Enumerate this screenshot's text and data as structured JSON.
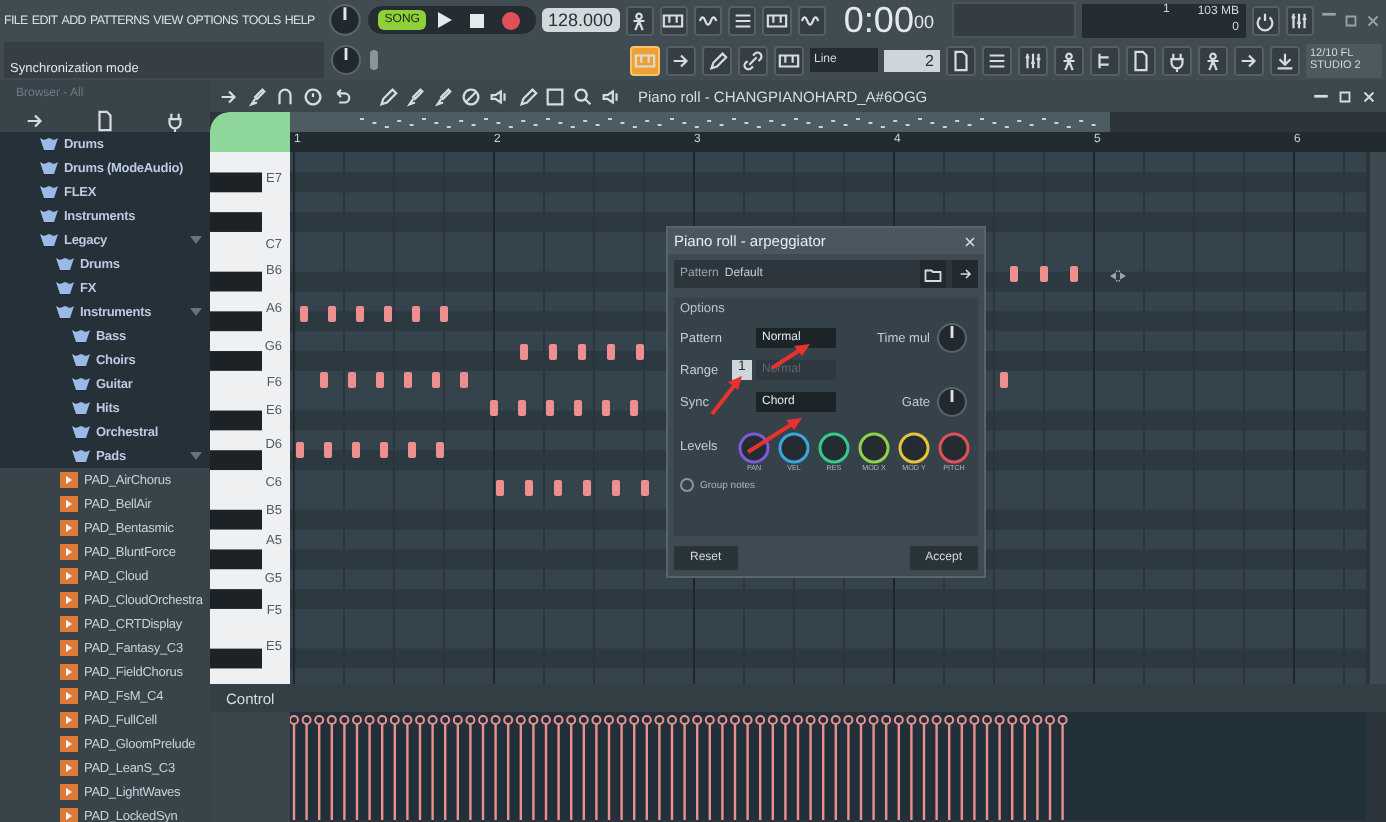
{
  "menu": [
    "FILE",
    "EDIT",
    "ADD",
    "PATTERNS",
    "VIEW",
    "OPTIONS",
    "TOOLS",
    "HELP"
  ],
  "top_bar": {
    "mode": "SONG",
    "tempo": "128.000",
    "time": "0:00",
    "time_fraction": "00",
    "cpu": "1",
    "memory": "103 MB",
    "polyphony": "0",
    "hint": "Synchronization mode",
    "snap": "Line",
    "step": "2",
    "news": [
      "12/10 FL",
      "STUDIO 2"
    ]
  },
  "browser": {
    "title": "Browser - All",
    "tree": [
      {
        "label": "Drums",
        "kind": "folder",
        "expanded": false
      },
      {
        "label": "Drums (ModeAudio)",
        "kind": "folder",
        "expanded": false
      },
      {
        "label": "FLEX",
        "kind": "folder",
        "expanded": false
      },
      {
        "label": "Instruments",
        "kind": "folder",
        "expanded": false
      },
      {
        "label": "Legacy",
        "kind": "folder",
        "expanded": true,
        "children": [
          {
            "label": "Drums",
            "kind": "folder",
            "expanded": false
          },
          {
            "label": "FX",
            "kind": "folder",
            "expanded": false
          },
          {
            "label": "Instruments",
            "kind": "folder",
            "expanded": true,
            "children": [
              {
                "label": "Bass",
                "kind": "folder",
                "expanded": false
              },
              {
                "label": "Choirs",
                "kind": "folder",
                "expanded": false
              },
              {
                "label": "Guitar",
                "kind": "folder",
                "expanded": false
              },
              {
                "label": "Hits",
                "kind": "folder",
                "expanded": false
              },
              {
                "label": "Orchestral",
                "kind": "folder",
                "expanded": false
              },
              {
                "label": "Pads",
                "kind": "folder",
                "expanded": true,
                "children": [
                  {
                    "label": "PAD_AirChorus",
                    "kind": "file",
                    "expanded": false
                  },
                  {
                    "label": "PAD_BellAir",
                    "kind": "file",
                    "expanded": false
                  },
                  {
                    "label": "PAD_Bentasmic",
                    "kind": "file",
                    "expanded": false
                  },
                  {
                    "label": "PAD_BluntForce",
                    "kind": "file",
                    "expanded": false
                  },
                  {
                    "label": "PAD_Cloud",
                    "kind": "file",
                    "expanded": false
                  },
                  {
                    "label": "PAD_CloudOrchestra",
                    "kind": "file",
                    "expanded": false
                  },
                  {
                    "label": "PAD_CRTDisplay",
                    "kind": "file",
                    "expanded": false
                  },
                  {
                    "label": "PAD_Fantasy_C3",
                    "kind": "file",
                    "expanded": false
                  },
                  {
                    "label": "PAD_FieldChorus",
                    "kind": "file",
                    "expanded": false
                  },
                  {
                    "label": "PAD_FsM_C4",
                    "kind": "file",
                    "expanded": false
                  },
                  {
                    "label": "PAD_FullCell",
                    "kind": "file",
                    "expanded": false
                  },
                  {
                    "label": "PAD_GloomPrelude",
                    "kind": "file",
                    "expanded": false
                  },
                  {
                    "label": "PAD_LeanS_C3",
                    "kind": "file",
                    "expanded": false
                  },
                  {
                    "label": "PAD_LightWaves",
                    "kind": "file",
                    "expanded": false
                  },
                  {
                    "label": "PAD_LockedSyn",
                    "kind": "file",
                    "expanded": false
                  }
                ]
              }
            ]
          }
        ]
      }
    ]
  },
  "piano_roll": {
    "title": "Piano roll - CHANGPIANOHARD_A#6OGG",
    "bars": [
      "1",
      "2",
      "3",
      "4",
      "5",
      "6"
    ],
    "key_labels": [
      "E7",
      "C7",
      "B6",
      "A6",
      "G6",
      "F6",
      "E6",
      "D6",
      "C6",
      "B5",
      "A5",
      "G5",
      "F5",
      "E5"
    ],
    "control": "Control"
  },
  "arpeggiator": {
    "title": "Piano roll - arpeggiator",
    "preset_label": "Pattern",
    "preset": "Default",
    "section": "Options",
    "pattern_label": "Pattern",
    "pattern": {
      "value": "Normal",
      "disabled": false
    },
    "time_mul_label": "Time mul",
    "range_label": "Range",
    "range": "1",
    "range_pattern": {
      "value": "Normal",
      "disabled": true
    },
    "sync_label": "Sync",
    "sync": {
      "value": "Chord",
      "disabled": false
    },
    "gate_label": "Gate",
    "levels_label": "Levels",
    "levels": [
      {
        "label": "PAN",
        "color": "#7b5cd6"
      },
      {
        "label": "VEL",
        "color": "#3aa6e0"
      },
      {
        "label": "RES",
        "color": "#36c98a"
      },
      {
        "label": "MOD X",
        "color": "#8fd14a"
      },
      {
        "label": "MOD Y",
        "color": "#e8c23a"
      },
      {
        "label": "PITCH",
        "color": "#e0505a"
      }
    ],
    "group_notes": {
      "label": "Group notes",
      "checked": false
    },
    "buttons": [
      "Reset",
      "Accept"
    ]
  }
}
